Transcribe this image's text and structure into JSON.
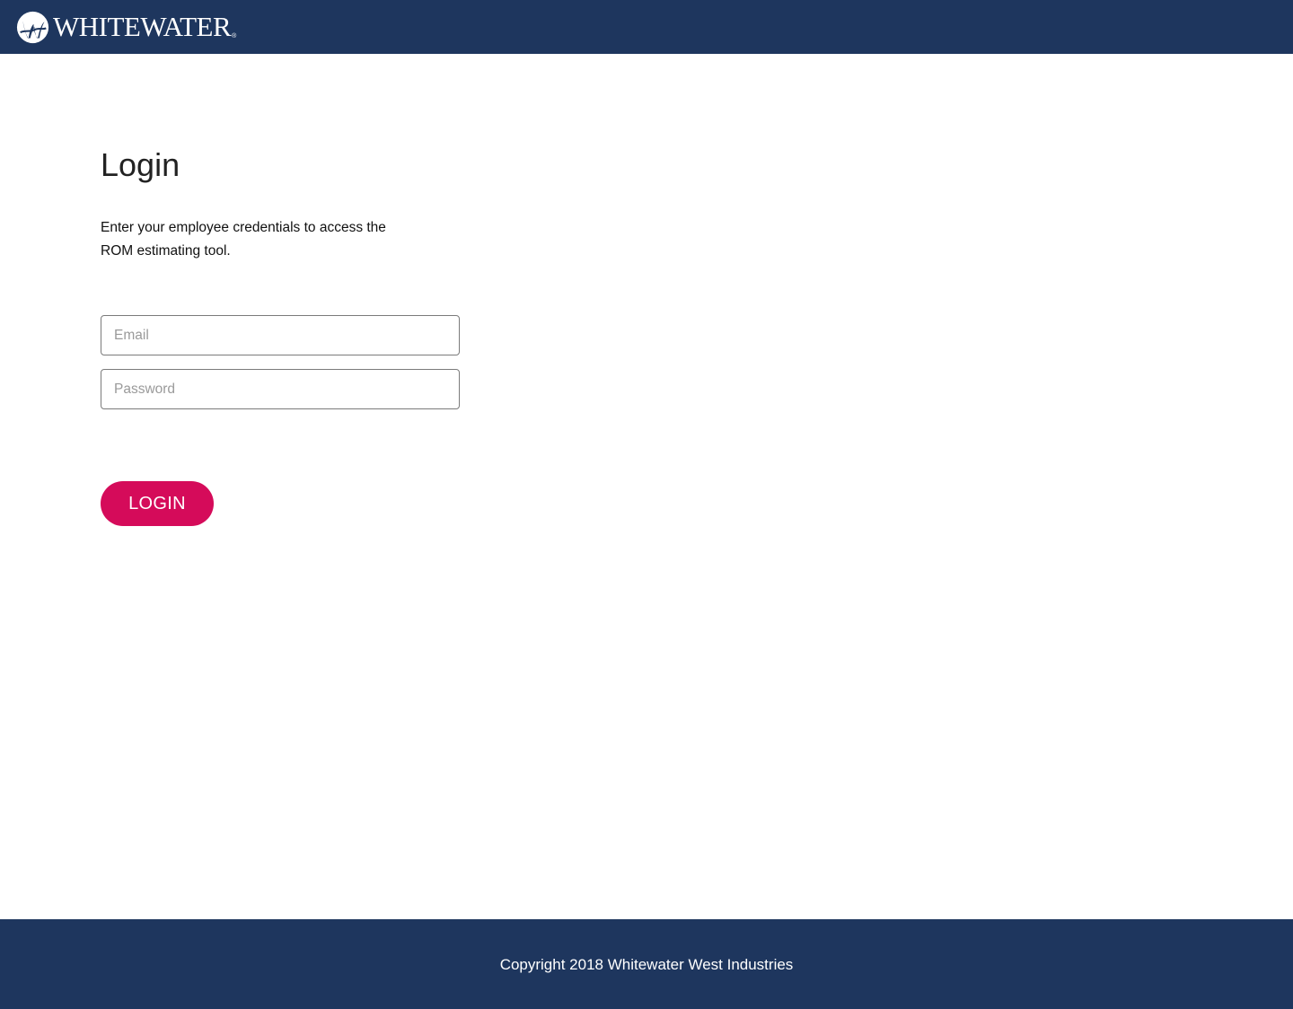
{
  "header": {
    "logo_text": "WHITEWATER",
    "logo_reg": "®"
  },
  "login": {
    "title": "Login",
    "intro": "Enter your employee credentials to access the ROM estimating tool.",
    "email_placeholder": "Email",
    "email_value": "",
    "password_placeholder": "Password",
    "password_value": "",
    "button_label": "LOGIN"
  },
  "footer": {
    "copyright": "Copyright 2018 Whitewater West Industries"
  },
  "colors": {
    "header_bg": "#1e365e",
    "footer_bg": "#1e365e",
    "button_bg": "#d50b5a",
    "text": "#222222"
  },
  "icons": {
    "logo": "whitewater-logo-icon"
  }
}
